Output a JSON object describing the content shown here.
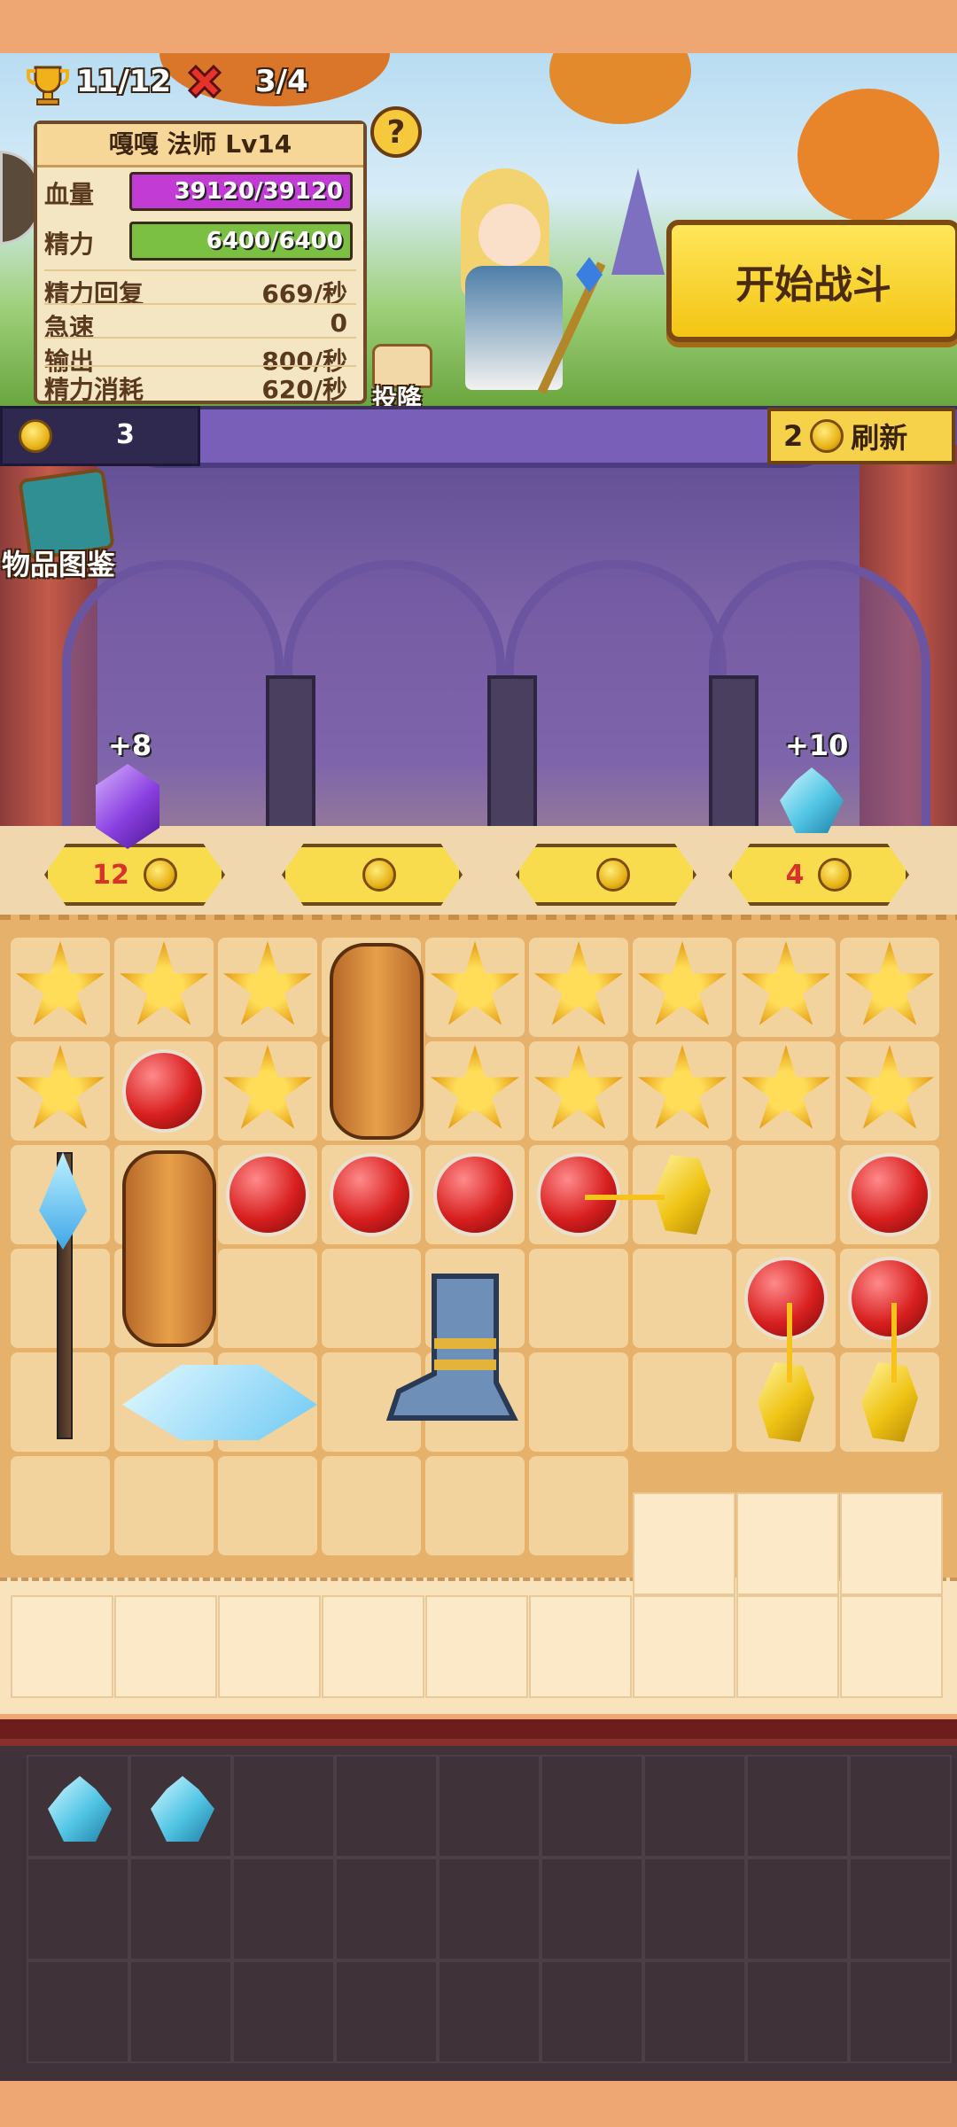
{
  "topbar": {
    "trophy_count": "11/12",
    "lives": "3/4"
  },
  "hero": {
    "title": "嘎嘎 法师 Lv14",
    "stats": [
      {
        "label": "血量",
        "value": "39120/39120"
      },
      {
        "label": "精力",
        "value": "6400/6400"
      },
      {
        "label": "精力回复",
        "value": "669/秒"
      },
      {
        "label": "急速",
        "value": "0"
      },
      {
        "label": "输出",
        "value": "800/秒"
      },
      {
        "label": "精力消耗",
        "value": "620/秒"
      }
    ],
    "hp_fill": 1.0,
    "energy_fill": 1.0
  },
  "buttons": {
    "start": "开始战斗",
    "surrender": "投降",
    "refresh": "刷新",
    "refresh_cost": "2",
    "help": "?"
  },
  "shop": {
    "coins": "3",
    "catalog_label": "物品图鉴",
    "bonus_left": "+8",
    "bonus_right": "+10",
    "prices": [
      "12",
      "",
      "",
      "4"
    ]
  },
  "colors": {
    "hp_bar": "#c23bd4",
    "energy_bar": "#7bc043",
    "price_red": "#d9322a"
  },
  "icons": [
    "trophy-icon",
    "cross-icon",
    "help-icon",
    "book-icon",
    "coin-icon",
    "beer-icon",
    "star-icon",
    "red-orb-icon",
    "yellow-gem-icon",
    "blue-gem-icon",
    "purple-gem-icon",
    "staff-icon",
    "bread-icon",
    "boot-icon",
    "ice-tiles-icon"
  ]
}
